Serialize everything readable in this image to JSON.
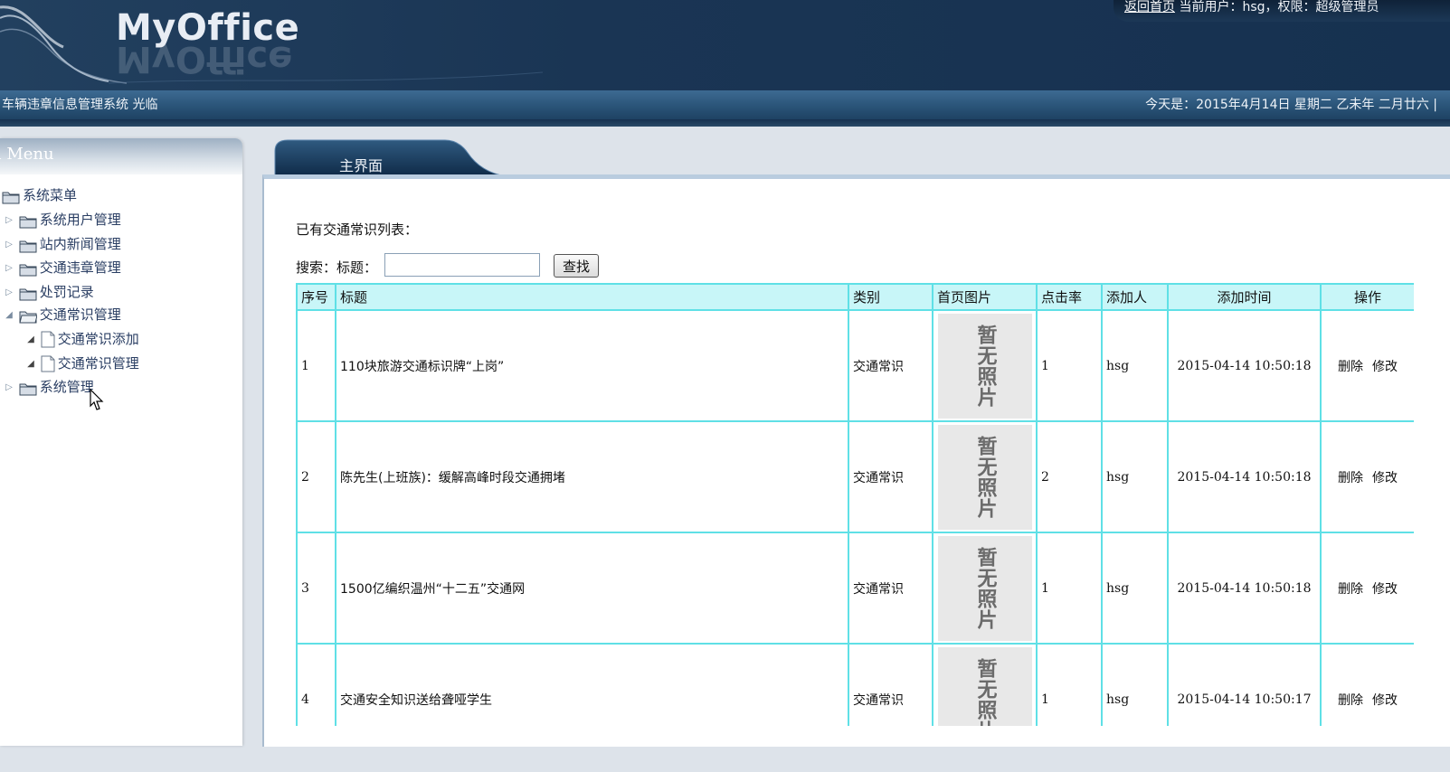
{
  "header": {
    "logo": "MyOffice",
    "home_link": "返回首页",
    "user_info": "当前用户：hsg，权限：超级管理员"
  },
  "info_bar": {
    "system_title": "车辆违章信息管理系统 光临",
    "date_text": "今天是：2015年4月14日 星期二 乙未年 二月廿六 |"
  },
  "sidebar": {
    "title": "n Menu",
    "items": [
      {
        "label": "系统菜单",
        "type": "folder"
      },
      {
        "label": "系统用户管理",
        "type": "folder"
      },
      {
        "label": "站内新闻管理",
        "type": "folder"
      },
      {
        "label": "交通违章管理",
        "type": "folder"
      },
      {
        "label": "处罚记录",
        "type": "folder"
      },
      {
        "label": "交通常识管理",
        "type": "folder"
      },
      {
        "label": "交通常识添加",
        "type": "page"
      },
      {
        "label": "交通常识管理",
        "type": "page"
      },
      {
        "label": "系统管理",
        "type": "folder"
      }
    ]
  },
  "main": {
    "tab_label": "主界面",
    "list_heading": "已有交通常识列表：",
    "search": {
      "label": "搜索：标题：",
      "value": "",
      "button": "查找"
    },
    "table": {
      "headers": [
        "序号",
        "标题",
        "类别",
        "首页图片",
        "点击率",
        "添加人",
        "添加时间",
        "操作"
      ],
      "no_photo_text": "暂无照片",
      "delete_label": "删除",
      "edit_label": "修改",
      "rows": [
        {
          "id": "1",
          "title": "110块旅游交通标识牌“上岗”",
          "category": "交通常识",
          "clicks": "1",
          "author": "hsg",
          "time": "2015-04-14 10:50:18"
        },
        {
          "id": "2",
          "title": "陈先生(上班族)：缓解高峰时段交通拥堵",
          "category": "交通常识",
          "clicks": "2",
          "author": "hsg",
          "time": "2015-04-14 10:50:18"
        },
        {
          "id": "3",
          "title": "1500亿编织温州“十二五”交通网",
          "category": "交通常识",
          "clicks": "1",
          "author": "hsg",
          "time": "2015-04-14 10:50:18"
        },
        {
          "id": "4",
          "title": "交通安全知识送给聋哑学生",
          "category": "交通常识",
          "clicks": "1",
          "author": "hsg",
          "time": "2015-04-14 10:50:17"
        }
      ]
    }
  },
  "colors": {
    "header_bg": "#1a3554",
    "table_border": "#5fe0e6",
    "table_header_bg": "#c8f6f8",
    "tree_text": "#2a3e63"
  },
  "icons": [
    "folder-icon",
    "page-icon",
    "expand-arrow-icon",
    "collapse-arrow-icon",
    "mouse-cursor-icon"
  ]
}
